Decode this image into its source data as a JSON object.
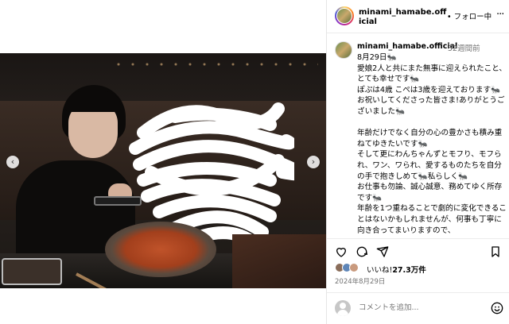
{
  "header": {
    "username": "minami_hamabe.official",
    "follow_status": "• フォロー中",
    "more": "···"
  },
  "caption": {
    "username": "minami_hamabe.official",
    "time_ago": "52週間前",
    "text": "8月29日🐜\n愛娘2人と共にまた無事に迎えられたこと、とても幸せです🐜\nぽぷは4歳 こぺは3歳を迎えております🐜\nお祝いしてくださった皆さま!ありがとうございました🐜\n\n年齢だけでなく自分の心の豊かさも積み重ねてゆきたいです🐜\nそして更にわんちゃんずとモフり、モフられ、ワン、ワられ、愛するものたちを自分の手で抱きしめて🐜私らしく🐜\nお仕事も勿論、誠心誠意、務めてゆく所存です🐜\n年齢を1つ重ねることで劇的に変化できることはないかもしれませんが、何事も丁寧に向き合ってまいりますので、"
  },
  "likes": {
    "label": "いいね!",
    "count": "27.3万件"
  },
  "date": "2024年8月29日",
  "comment": {
    "placeholder": "コメントを追加..."
  },
  "media": {
    "prev": "‹",
    "next": "›"
  },
  "colors": {
    "accent": "#0095f6",
    "secondary_text": "#737373",
    "border": "#ececec"
  }
}
